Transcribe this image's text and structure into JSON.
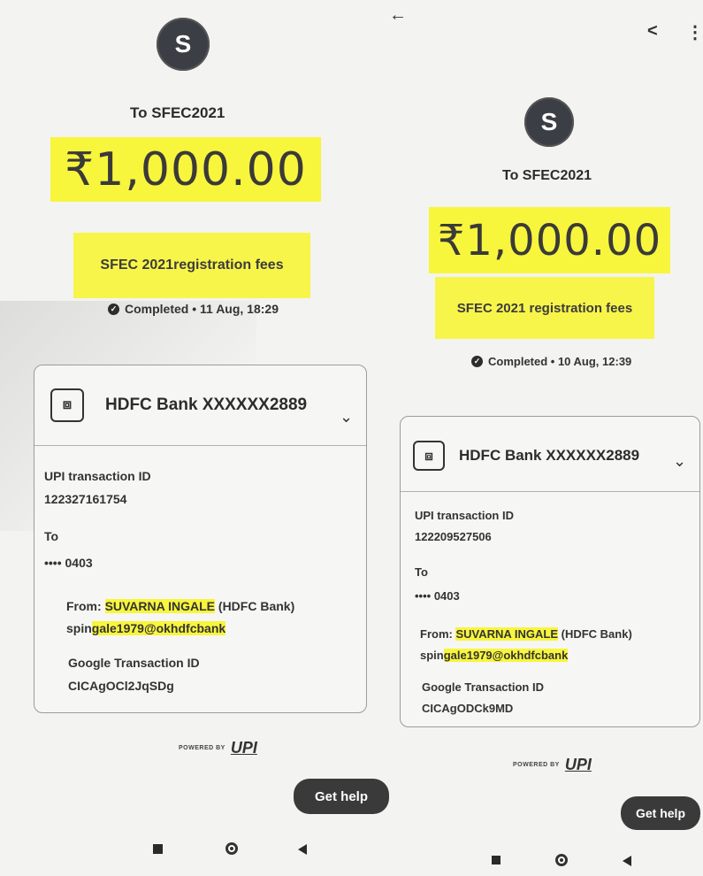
{
  "left": {
    "avatar_letter": "S",
    "to_label": "To SFEC2021",
    "amount": "₹1,000.00",
    "note": "SFEC 2021registration fees",
    "status": "Completed • 11 Aug, 18:29",
    "bank": "HDFC Bank XXXXXX2889",
    "upi_id_label": "UPI transaction ID",
    "upi_id": "122327161754",
    "to_heading": "To",
    "to_value": "•••• 0403",
    "from_prefix": "From: ",
    "from_name": "SUVARNA INGALE",
    "from_bank": " (HDFC Bank)",
    "vpa_prefix": "spin",
    "vpa_rest": "gale1979@okhdfcbank",
    "google_label": "Google Transaction ID",
    "google_id": "CICAgOCl2JqSDg",
    "powered": "POWERED BY",
    "upi": "UPI",
    "help": "Get help"
  },
  "right": {
    "avatar_letter": "S",
    "to_label": "To SFEC2021",
    "amount": "₹1,000.00",
    "note": "SFEC 2021 registration fees",
    "status": "Completed • 10 Aug, 12:39",
    "bank": "HDFC Bank XXXXXX2889",
    "upi_id_label": "UPI transaction ID",
    "upi_id": "122209527506",
    "to_heading": "To",
    "to_value": "•••• 0403",
    "from_prefix": "From: ",
    "from_name": "SUVARNA INGALE",
    "from_bank": " (HDFC Bank)",
    "vpa_prefix": "spin",
    "vpa_rest": "gale1979@okhdfcbank",
    "google_label": "Google Transaction ID",
    "google_id": "CICAgODCk9MD",
    "powered": "POWERED BY",
    "upi": "UPI",
    "help": "Get help"
  },
  "icons": {
    "back": "←",
    "share": "<",
    "more": "⋮",
    "chevron": "⌄",
    "check": "✓"
  },
  "highlight_color": "#f8f53d"
}
